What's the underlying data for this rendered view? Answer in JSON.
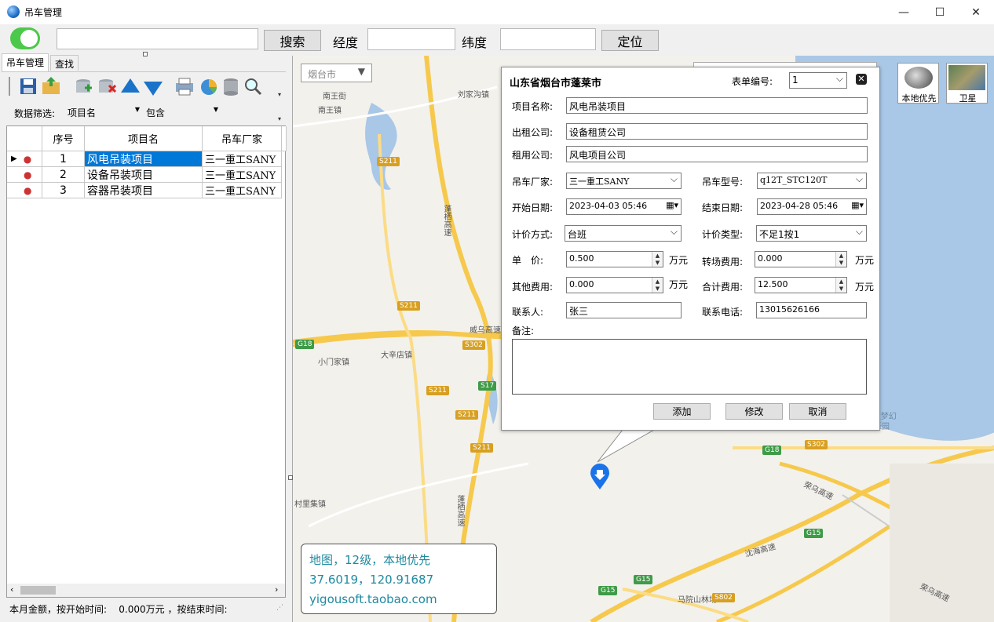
{
  "window": {
    "title": "吊车管理",
    "minimize": "—",
    "maximize": "☐",
    "close": "✕"
  },
  "toolbar": {
    "search_value": "",
    "search_button": "搜索",
    "lng_label": "经度",
    "lng_value": "",
    "lat_label": "纬度",
    "lat_value": "",
    "locate_button": "定位"
  },
  "left": {
    "tabs": [
      {
        "label": "吊车管理"
      },
      {
        "label": "查找"
      }
    ],
    "filter_label": "数据筛选:",
    "filter_field": "项目名",
    "filter_op": "包含",
    "columns": [
      "序号",
      "项目名",
      "吊车厂家"
    ],
    "rows": [
      {
        "no": "1",
        "name": "风电吊装项目",
        "maker": "三一重工SANY"
      },
      {
        "no": "2",
        "name": "设备吊装项目",
        "maker": "三一重工SANY"
      },
      {
        "no": "3",
        "name": "容器吊装项目",
        "maker": "三一重工SANY"
      }
    ],
    "status": "本月金额，按开始时间:    0.000万元 ，按结束时间:"
  },
  "map": {
    "city_select": "烟台市",
    "local_first": "本地优先",
    "satellite": "卫星",
    "labels": {
      "nanwangjie": "南王街",
      "nanwangzhen": "南王镇",
      "liujia": "刘家沟镇",
      "xiaomen": "小门家镇",
      "daxin": "大辛店镇",
      "cunli": "村里集镇",
      "mayuan": "马院山林场",
      "penglai_high": "蓬栖高速",
      "weiwu": "威乌高速",
      "rongwu": "荣乌高速",
      "shenhai": "沈海高速",
      "haiyang": "海水乐园",
      "dream": "蓬莱(度梦幻"
    },
    "info": {
      "line1": "地图，12级，本地优先",
      "line2": "37.6019，120.91687",
      "line3": "yigousoft.taobao.com"
    }
  },
  "dialog": {
    "region": "山东省烟台市蓬莱市",
    "form_no_label": "表单编号:",
    "form_no": "1",
    "project_label": "项目名称:",
    "project": "风电吊装项目",
    "lessor_label": "出租公司:",
    "lessor": "设备租赁公司",
    "lessee_label": "租用公司:",
    "lessee": "风电项目公司",
    "maker_label": "吊车厂家:",
    "maker": "三一重工SANY",
    "model_label": "吊车型号:",
    "model": "q12T_STC120T",
    "start_label": "开始日期:",
    "start": "2023-04-03 05:46",
    "end_label": "结束日期:",
    "end": "2023-04-28 05:46",
    "pricing_label": "计价方式:",
    "pricing": "台班",
    "pricing_type_label": "计价类型:",
    "pricing_type": "不足1按1",
    "unit_price_label": "单　价:",
    "unit_price": "0.500",
    "transfer_label": "转场费用:",
    "transfer": "0.000",
    "other_label": "其他费用:",
    "other": "0.000",
    "total_label": "合计费用:",
    "total": "12.500",
    "unit": "万元",
    "contact_label": "联系人:",
    "contact": "张三",
    "phone_label": "联系电话:",
    "phone": "13015626166",
    "notes_label": "备注:",
    "notes": "",
    "add": "添加",
    "edit": "修改",
    "cancel": "取消"
  }
}
